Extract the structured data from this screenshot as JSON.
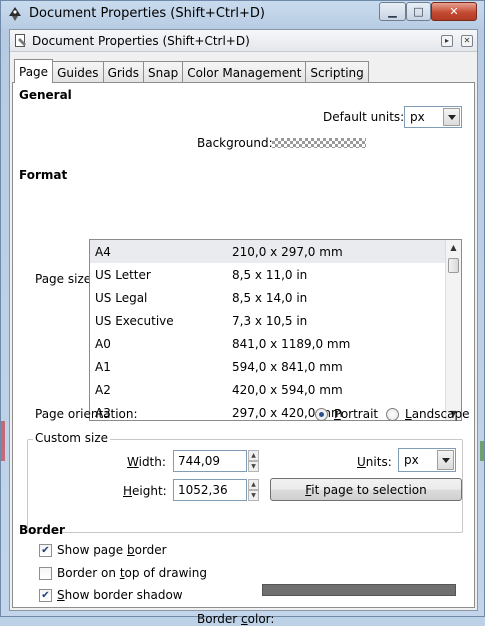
{
  "window": {
    "title": "Document Properties (Shift+Ctrl+D)",
    "minimize_glyph": "▁",
    "maximize_glyph": "□",
    "close_glyph": "✕"
  },
  "panel": {
    "title": "Document Properties (Shift+Ctrl+D)",
    "collapse_glyph": "▸",
    "close_glyph": "✕"
  },
  "tabs": [
    "Page",
    "Guides",
    "Grids",
    "Snap",
    "Color Management",
    "Scripting"
  ],
  "general": {
    "heading": "General",
    "default_units_label": "Default units:",
    "default_units_value": "px",
    "background_label": "Background:"
  },
  "format": {
    "heading": "Format",
    "page_size_label": "Page size:",
    "page_sizes": [
      {
        "name": "A4",
        "size": "210,0 x 297,0 mm"
      },
      {
        "name": "US Letter",
        "size": "8,5 x 11,0 in"
      },
      {
        "name": "US Legal",
        "size": "8,5 x 14,0 in"
      },
      {
        "name": "US Executive",
        "size": "7,3 x 10,5 in"
      },
      {
        "name": "A0",
        "size": "841,0 x 1189,0 mm"
      },
      {
        "name": "A1",
        "size": "594,0 x 841,0 mm"
      },
      {
        "name": "A2",
        "size": "420,0 x 594,0 mm"
      },
      {
        "name": "A3",
        "size": "297,0 x 420,0 mm"
      }
    ],
    "selected_page_size": "A4",
    "orientation_label": "Page orientation:",
    "portrait_label": "Portrait",
    "landscape_label": "Landscape",
    "orientation_value": "Portrait"
  },
  "custom_size": {
    "legend": "Custom size",
    "width_label": "Width:",
    "width_value": "744,09",
    "height_label": "Height:",
    "height_value": "1052,36",
    "units_label": "Units:",
    "units_value": "px",
    "fit_button": "Fit page to selection"
  },
  "border": {
    "heading": "Border",
    "show_page_border": {
      "label": "Show page border",
      "checked": true
    },
    "border_on_top": {
      "label": "Border on top of drawing",
      "checked": false
    },
    "show_border_shadow": {
      "label": "Show border shadow",
      "checked": true
    },
    "border_color_label": "Border color:",
    "border_color": "#6f6f6f"
  },
  "colors": {
    "selection_bg": "#e9ebee",
    "radio_dot": "#2a4e8c",
    "close_button": "#c54b32"
  }
}
